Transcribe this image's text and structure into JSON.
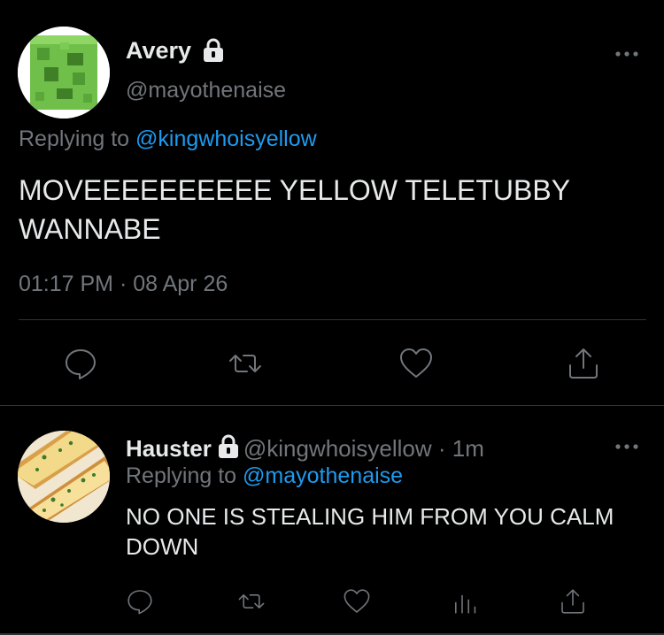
{
  "colors": {
    "background": "#000000",
    "text_primary": "#e7e9ea",
    "text_secondary": "#71767b",
    "link": "#1d9bf0",
    "divider": "#2f3336"
  },
  "main_tweet": {
    "avatar_icon": "green-slime-cube-avatar",
    "display_name": "Avery",
    "protected_icon": "lock-icon",
    "handle": "@mayothenaise",
    "more_icon": "more-dots-icon",
    "replying_prefix": "Replying to ",
    "replying_to": "@kingwhoisyellow",
    "text": "MOVEEEEEEEEEE YELLOW TELETUBBY WANNABE",
    "timestamp": "01:17 PM · 08 Apr 26",
    "actions": [
      "reply-icon",
      "retweet-icon",
      "like-icon",
      "share-icon"
    ]
  },
  "reply_tweet": {
    "avatar_icon": "garlic-bread-avatar",
    "display_name": "Hauster",
    "protected_icon": "lock-icon",
    "handle": "@kingwhoisyellow",
    "separator": " · ",
    "time_ago": "1m",
    "more_icon": "more-dots-icon",
    "replying_prefix": "Replying to ",
    "replying_to": "@mayothenaise",
    "text": "NO ONE IS STEALING HIM FROM YOU CALM DOWN",
    "actions": [
      "reply-icon",
      "retweet-icon",
      "like-icon",
      "views-icon",
      "share-icon"
    ]
  }
}
